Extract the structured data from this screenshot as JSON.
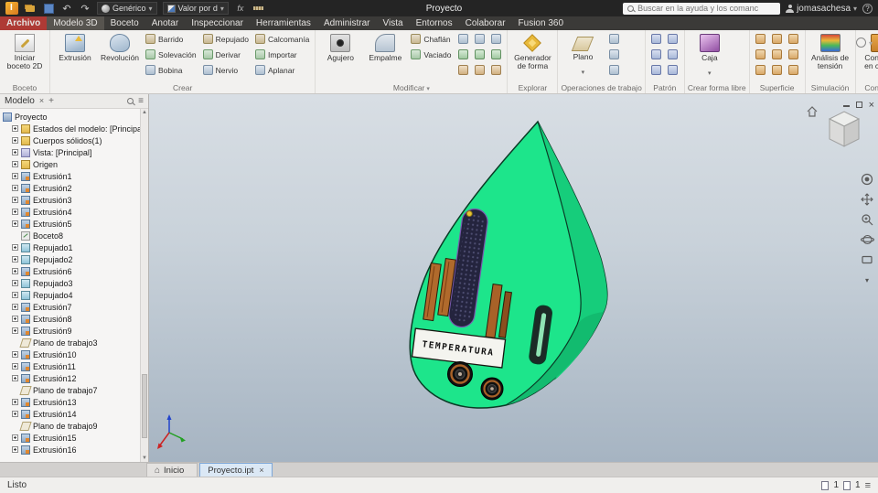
{
  "titlebar": {
    "doc_title": "Proyecto",
    "material_value": "Genérico",
    "appearance_value": "Valor por d",
    "search_placeholder": "Buscar en la ayuda y los comanc",
    "user": "jomasachesa"
  },
  "tabs": [
    {
      "label": "Archivo",
      "cls": "file"
    },
    {
      "label": "Modelo 3D",
      "cls": "active"
    },
    {
      "label": "Boceto"
    },
    {
      "label": "Anotar"
    },
    {
      "label": "Inspeccionar"
    },
    {
      "label": "Herramientas"
    },
    {
      "label": "Administrar"
    },
    {
      "label": "Vista"
    },
    {
      "label": "Entornos"
    },
    {
      "label": "Colaborar"
    },
    {
      "label": "Fusion 360"
    }
  ],
  "ribbon": {
    "boceto": {
      "group": "Boceto",
      "start_sketch": "Iniciar boceto 2D"
    },
    "crear": {
      "group": "Crear",
      "extrude": "Extrusión",
      "revolve": "Revolución",
      "col1": [
        "Barrido",
        "Solevación",
        "Bobina"
      ],
      "col2": [
        "Repujado",
        "Derivar",
        "Nervio"
      ],
      "col3": [
        "Calcomanía",
        "Importar",
        "Aplanar"
      ]
    },
    "modificar": {
      "group": "Modificar",
      "hole": "Agujero",
      "fillet": "Empalme",
      "col1": [
        "Chaflán",
        "Vaciado"
      ]
    },
    "explorar": {
      "group": "Explorar",
      "shape_generator": "Generador de forma"
    },
    "trabajo": {
      "group": "Operaciones de trabajo",
      "plane": "Plano"
    },
    "patron": {
      "group": "Patrón"
    },
    "forma_libre": {
      "group": "Crear forma libre",
      "box": "Caja"
    },
    "superficie": {
      "group": "Superficie"
    },
    "simulacion": {
      "group": "Simulación",
      "stress": "Análisis de tensión"
    },
    "convertir": {
      "group": "Convertir",
      "sheet": "Convertir en chapa"
    }
  },
  "browser": {
    "panel_title": "Modelo",
    "items": [
      {
        "label": "Proyecto",
        "type": "root",
        "exp": false
      },
      {
        "label": "Estados del modelo: [Principal]",
        "type": "folder",
        "exp": true
      },
      {
        "label": "Cuerpos sólidos(1)",
        "type": "folder",
        "exp": true
      },
      {
        "label": "Vista: [Principal]",
        "type": "view",
        "exp": true
      },
      {
        "label": "Origen",
        "type": "folder",
        "exp": true
      },
      {
        "label": "Extrusión1",
        "type": "extrude",
        "exp": true
      },
      {
        "label": "Extrusión2",
        "type": "extrude",
        "exp": true
      },
      {
        "label": "Extrusión3",
        "type": "extrude",
        "exp": true
      },
      {
        "label": "Extrusión4",
        "type": "extrude",
        "exp": true
      },
      {
        "label": "Extrusión5",
        "type": "extrude",
        "exp": true
      },
      {
        "label": "Boceto8",
        "type": "sketch",
        "exp": false
      },
      {
        "label": "Repujado1",
        "type": "emboss",
        "exp": true
      },
      {
        "label": "Repujado2",
        "type": "emboss",
        "exp": true
      },
      {
        "label": "Extrusión6",
        "type": "extrude",
        "exp": true
      },
      {
        "label": "Repujado3",
        "type": "emboss",
        "exp": true
      },
      {
        "label": "Repujado4",
        "type": "emboss",
        "exp": true
      },
      {
        "label": "Extrusión7",
        "type": "extrude",
        "exp": true
      },
      {
        "label": "Extrusión8",
        "type": "extrude",
        "exp": true
      },
      {
        "label": "Extrusión9",
        "type": "extrude",
        "exp": true
      },
      {
        "label": "Plano de trabajo3",
        "type": "plane",
        "exp": false
      },
      {
        "label": "Extrusión10",
        "type": "extrude",
        "exp": true
      },
      {
        "label": "Extrusión11",
        "type": "extrude",
        "exp": true
      },
      {
        "label": "Extrusión12",
        "type": "extrude",
        "exp": true
      },
      {
        "label": "Plano de trabajo7",
        "type": "plane",
        "exp": false
      },
      {
        "label": "Extrusión13",
        "type": "extrude",
        "exp": true
      },
      {
        "label": "Extrusión14",
        "type": "extrude",
        "exp": true
      },
      {
        "label": "Plano de trabajo9",
        "type": "plane",
        "exp": false
      },
      {
        "label": "Extrusión15",
        "type": "extrude",
        "exp": true
      },
      {
        "label": "Extrusión16",
        "type": "extrude",
        "exp": true
      }
    ]
  },
  "viewport": {
    "model_label": "TEMPERATURA"
  },
  "doc_tabs": [
    {
      "label": "Inicio",
      "cls": "home"
    },
    {
      "label": "Proyecto.ipt",
      "cls": "active",
      "close": "×"
    }
  ],
  "statusbar": {
    "ready": "Listo",
    "count1": "1",
    "count2": "1"
  },
  "colors": {
    "model_green": "#1de58b",
    "model_green_side": "#16cd7b",
    "viewport_top": "#d8dee4",
    "viewport_bottom": "#a6b4c2",
    "archivo_tab_red": "#ae3a35",
    "active_doc_tab": "#dbe8f5"
  }
}
